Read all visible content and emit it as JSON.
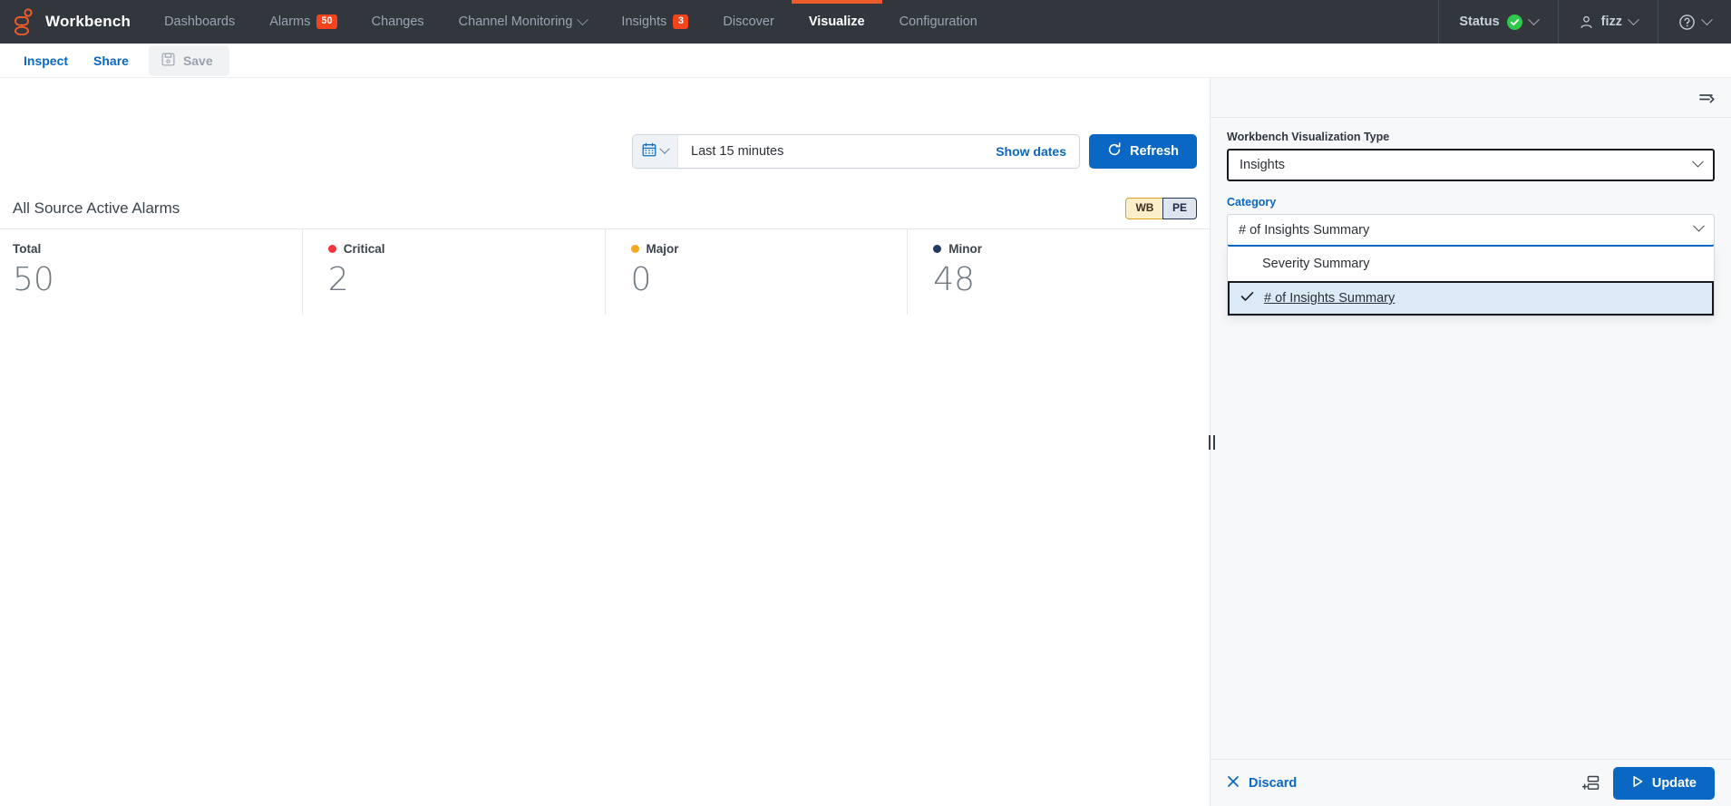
{
  "topnav": {
    "brand": "Workbench",
    "logo_color": "#ec5b29",
    "items": [
      {
        "label": "Dashboards",
        "badge": null,
        "caret": false,
        "active": false
      },
      {
        "label": "Alarms",
        "badge": "50",
        "caret": false,
        "active": false
      },
      {
        "label": "Changes",
        "badge": null,
        "caret": false,
        "active": false
      },
      {
        "label": "Channel Monitoring",
        "badge": null,
        "caret": true,
        "active": false
      },
      {
        "label": "Insights",
        "badge": "3",
        "caret": false,
        "active": false
      },
      {
        "label": "Discover",
        "badge": null,
        "caret": false,
        "active": false
      },
      {
        "label": "Visualize",
        "badge": null,
        "caret": false,
        "active": true
      },
      {
        "label": "Configuration",
        "badge": null,
        "caret": false,
        "active": false
      }
    ],
    "status_label": "Status",
    "status_state": "ok",
    "user_label": "fizz",
    "badge_color": "#f4441e",
    "active_underline_color": "#ec5b29"
  },
  "actionbar": {
    "inspect": "Inspect",
    "share": "Share",
    "save": "Save",
    "save_enabled": false
  },
  "daterange": {
    "value": "Last 15 minutes",
    "show_dates": "Show dates",
    "refresh": "Refresh"
  },
  "panel": {
    "title": "All Source Active Alarms",
    "badges": [
      {
        "label": "WB",
        "bg": "#fbeeca",
        "border": "#e0a020"
      },
      {
        "label": "PE",
        "bg": "#dfe5ef",
        "border": "#23375c"
      }
    ],
    "stats": [
      {
        "label": "Total",
        "value": "50",
        "dot": null
      },
      {
        "label": "Critical",
        "value": "2",
        "dot": "#f5333f"
      },
      {
        "label": "Major",
        "value": "0",
        "dot": "#f5a623"
      },
      {
        "label": "Minor",
        "value": "48",
        "dot": "#1f3864"
      }
    ]
  },
  "config": {
    "viz_type": {
      "label": "Workbench Visualization Type",
      "value": "Insights"
    },
    "category": {
      "label": "Category",
      "value": "# of Insights Summary",
      "options": [
        {
          "label": "Severity Summary",
          "selected": false
        },
        {
          "label": "# of Insights Summary",
          "selected": true
        }
      ]
    },
    "footer": {
      "discard": "Discard",
      "update": "Update"
    }
  }
}
